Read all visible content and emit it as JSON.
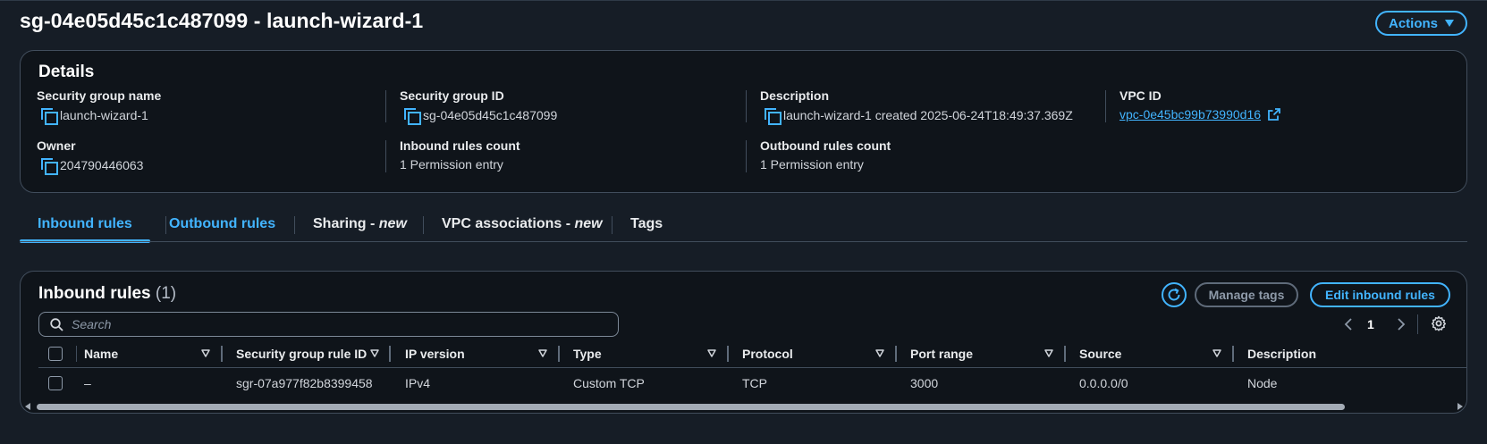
{
  "header": {
    "title": "sg-04e05d45c1c487099 - launch-wizard-1",
    "actions_label": "Actions"
  },
  "details": {
    "title": "Details",
    "fields": {
      "sg_name": {
        "label": "Security group name",
        "value": "launch-wizard-1"
      },
      "sg_id": {
        "label": "Security group ID",
        "value": "sg-04e05d45c1c487099"
      },
      "description": {
        "label": "Description",
        "value": "launch-wizard-1 created 2025-06-24T18:49:37.369Z"
      },
      "vpc_id": {
        "label": "VPC ID",
        "value": "vpc-0e45bc99b73990d16"
      },
      "owner": {
        "label": "Owner",
        "value": "204790446063"
      },
      "inbound_count": {
        "label": "Inbound rules count",
        "value": "1 Permission entry"
      },
      "outbound_count": {
        "label": "Outbound rules count",
        "value": "1 Permission entry"
      }
    }
  },
  "tabs": [
    {
      "label": "Inbound rules",
      "suffix": ""
    },
    {
      "label": "Outbound rules",
      "suffix": ""
    },
    {
      "label": "Sharing - ",
      "suffix": "new"
    },
    {
      "label": "VPC associations - ",
      "suffix": "new"
    },
    {
      "label": "Tags",
      "suffix": ""
    }
  ],
  "inbound_rules": {
    "title": "Inbound rules",
    "count": "(1)",
    "manage_tags_label": "Manage tags",
    "edit_label": "Edit inbound rules",
    "search_placeholder": "Search",
    "page_number": "1",
    "columns": [
      "Name",
      "Security group rule ID",
      "IP version",
      "Type",
      "Protocol",
      "Port range",
      "Source",
      "Description"
    ],
    "rows": [
      {
        "name": "–",
        "rule_id": "sgr-07a977f82b8399458",
        "ip_version": "IPv4",
        "type": "Custom TCP",
        "protocol": "TCP",
        "port_range": "3000",
        "source": "0.0.0.0/0",
        "description": "Node"
      }
    ]
  },
  "colors": {
    "background": "#161d26",
    "card": "#0f141a",
    "accent": "#42b4ff",
    "border": "#414d5c"
  }
}
